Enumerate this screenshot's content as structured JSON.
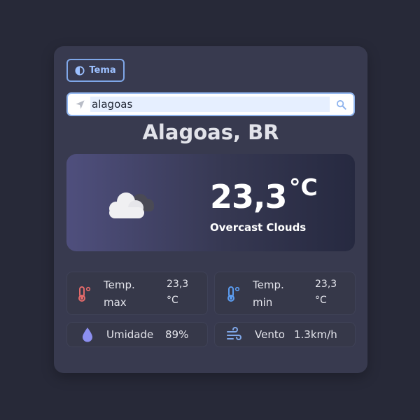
{
  "theme_button": {
    "label": "Tema"
  },
  "search": {
    "value": "alagoas"
  },
  "location": {
    "city": "Alagoas, BR"
  },
  "current": {
    "temp": "23,3",
    "unit": "°C",
    "description": "Overcast Clouds"
  },
  "stats": {
    "temp_max": {
      "label_line1": "Temp.",
      "label_line2": "max",
      "value_line1": "23,3",
      "value_line2": "°C"
    },
    "temp_min": {
      "label_line1": "Temp.",
      "label_line2": "min",
      "value_line1": "23,3",
      "value_line2": "°C"
    },
    "humidity": {
      "label": "Umidade",
      "value": "89%"
    },
    "wind": {
      "label": "Vento",
      "value": "1.3km/h"
    }
  },
  "colors": {
    "page_bg": "#272938",
    "card_bg": "#383a4f",
    "accent": "#8fb4ee",
    "temp_max_icon": "#e36a6a",
    "temp_min_icon": "#5b9cf0",
    "humidity_icon": "#8c8ff0",
    "wind_icon": "#7fa7e8"
  },
  "icons": [
    "theme-contrast-icon",
    "location-arrow-icon",
    "search-icon",
    "overcast-cloud-icon",
    "thermometer-hot-icon",
    "thermometer-cold-icon",
    "droplet-icon",
    "wind-icon"
  ]
}
